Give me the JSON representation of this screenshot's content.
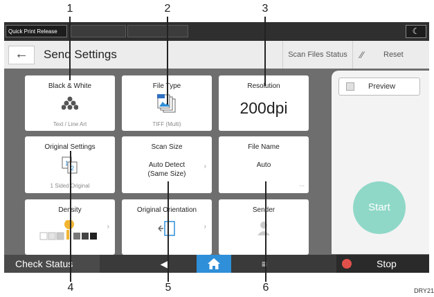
{
  "callouts": [
    "1",
    "2",
    "3",
    "4",
    "5",
    "6"
  ],
  "topbar": {
    "quick_print": "Quick Print Release",
    "moon_icon": "moon-icon"
  },
  "header": {
    "title": "Send Settings",
    "scan_files_status": "Scan Files Status",
    "reset": "Reset"
  },
  "tiles": {
    "black_white": {
      "title": "Black & White",
      "caption": "Text / Line Art"
    },
    "file_type": {
      "title": "File Type",
      "caption": "TIFF (Multi)"
    },
    "resolution": {
      "title": "Resolution",
      "value": "200dpi"
    },
    "original_settings": {
      "title": "Original Settings",
      "caption": "1 Sided Original"
    },
    "scan_size": {
      "title": "Scan Size",
      "value_line1": "Auto Detect",
      "value_line2": "(Same Size)"
    },
    "file_name": {
      "title": "File Name",
      "value": "Auto",
      "more": "..."
    },
    "density": {
      "title": "Density"
    },
    "original_orientation": {
      "title": "Original Orientation"
    },
    "sender": {
      "title": "Sender"
    }
  },
  "right_panel": {
    "preview": "Preview",
    "start": "Start"
  },
  "bottombar": {
    "check_status": "Check Status",
    "stop": "Stop"
  },
  "ref_code": "DRY21",
  "colors": {
    "home_blue": "#2f8fd8",
    "start_green": "#8fd8c8",
    "stop_red": "#e0504a",
    "density_yellow": "#f2b532"
  }
}
